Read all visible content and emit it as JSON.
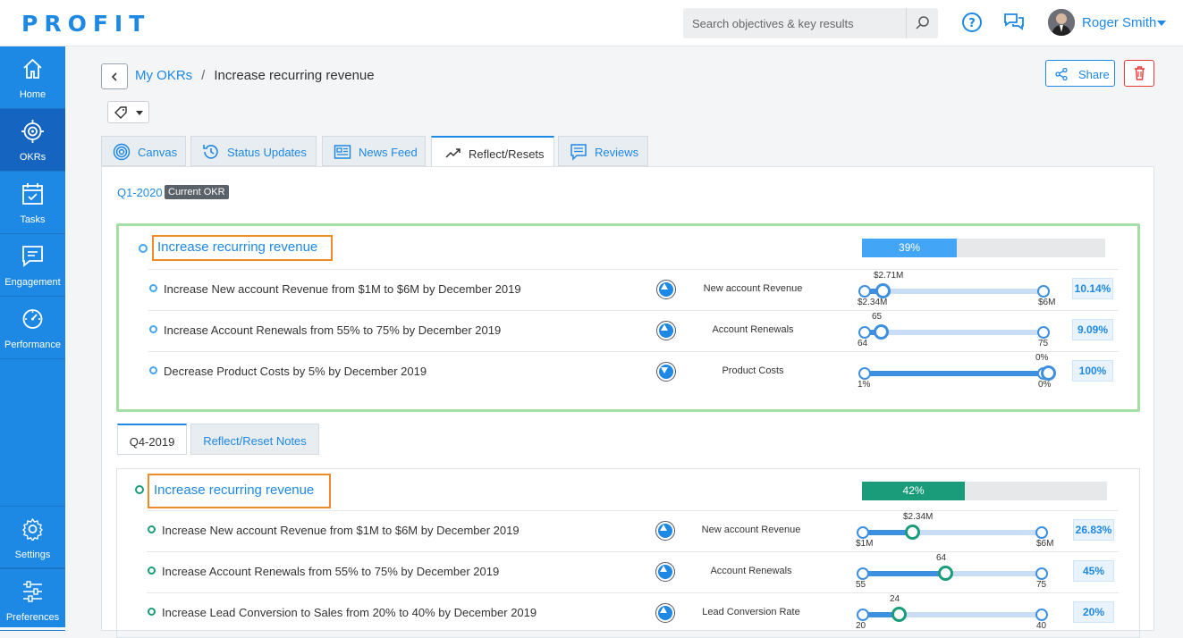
{
  "app": {
    "logo": "PROFIT"
  },
  "header": {
    "search_placeholder": "Search objectives & key results",
    "user_name": "Roger Smith"
  },
  "sidebar": {
    "items": [
      {
        "label": "Home",
        "icon": "home-icon"
      },
      {
        "label": "OKRs",
        "icon": "target-icon"
      },
      {
        "label": "Tasks",
        "icon": "calendar-check-icon"
      },
      {
        "label": "Engagement",
        "icon": "chat-icon"
      },
      {
        "label": "Performance",
        "icon": "gauge-icon"
      },
      {
        "label": "Settings",
        "icon": "gear-icon"
      },
      {
        "label": "Preferences",
        "icon": "sliders-icon"
      }
    ]
  },
  "breadcrumb": {
    "parent": "My OKRs",
    "separator": "/",
    "current": "Increase recurring revenue"
  },
  "actions": {
    "share": "Share"
  },
  "tabs": [
    {
      "label": "Canvas",
      "icon": "target-icon"
    },
    {
      "label": "Status Updates",
      "icon": "history-icon"
    },
    {
      "label": "News Feed",
      "icon": "newspaper-icon"
    },
    {
      "label": "Reflect/Resets",
      "icon": "trend-icon"
    },
    {
      "label": "Reviews",
      "icon": "review-icon"
    }
  ],
  "current": {
    "quarter": "Q1-2020",
    "badge": "Current OKR",
    "objective": "Increase recurring revenue",
    "progress": 39,
    "progress_label": "39%",
    "key_results": [
      {
        "text": "Increase New account Revenue from $1M to $6M by December 2019",
        "direction": "up",
        "metric": "New account Revenue",
        "start": "$2.34M",
        "end": "$6M",
        "current": "$2.71M",
        "fill": 0.1,
        "percent": "10.14%"
      },
      {
        "text": "Increase Account Renewals from 55% to 75% by December 2019",
        "direction": "up",
        "metric": "Account Renewals",
        "start": "64",
        "end": "75",
        "current": "65",
        "fill": 0.09,
        "percent": "9.09%"
      },
      {
        "text": "Decrease Product Costs by 5% by December 2019",
        "direction": "down",
        "metric": "Product Costs",
        "start": "1%",
        "end": "0%",
        "current": "0%",
        "fill": 1.0,
        "percent": "100%"
      }
    ]
  },
  "sub_tabs": [
    "Q4-2019",
    "Reflect/Reset Notes"
  ],
  "previous": {
    "objective": "Increase recurring revenue",
    "progress": 42,
    "progress_label": "42%",
    "key_results": [
      {
        "text": "Increase New account Revenue from $1M to $6M by December 2019",
        "metric": "New account Revenue",
        "start": "$1M",
        "end": "$6M",
        "current": "$2.34M",
        "fill": 0.27,
        "percent": "26.83%"
      },
      {
        "text": "Increase Account Renewals from 55% to 75% by December 2019",
        "metric": "Account Renewals",
        "start": "55",
        "end": "75",
        "current": "64",
        "fill": 0.45,
        "percent": "45%"
      },
      {
        "text": "Increase Lead Conversion to Sales from 20% to 40% by December 2019",
        "metric": "Lead Conversion Rate",
        "start": "20",
        "end": "40",
        "current": "24",
        "fill": 0.2,
        "percent": "20%"
      }
    ]
  },
  "colors": {
    "brand": "#1e88e5",
    "sidebar_active": "#1565c0",
    "progress_blue": "#42a5f5",
    "progress_green": "#1a9b7a",
    "highlight_orange": "#f08a28",
    "box_green": "#a6dca5"
  }
}
